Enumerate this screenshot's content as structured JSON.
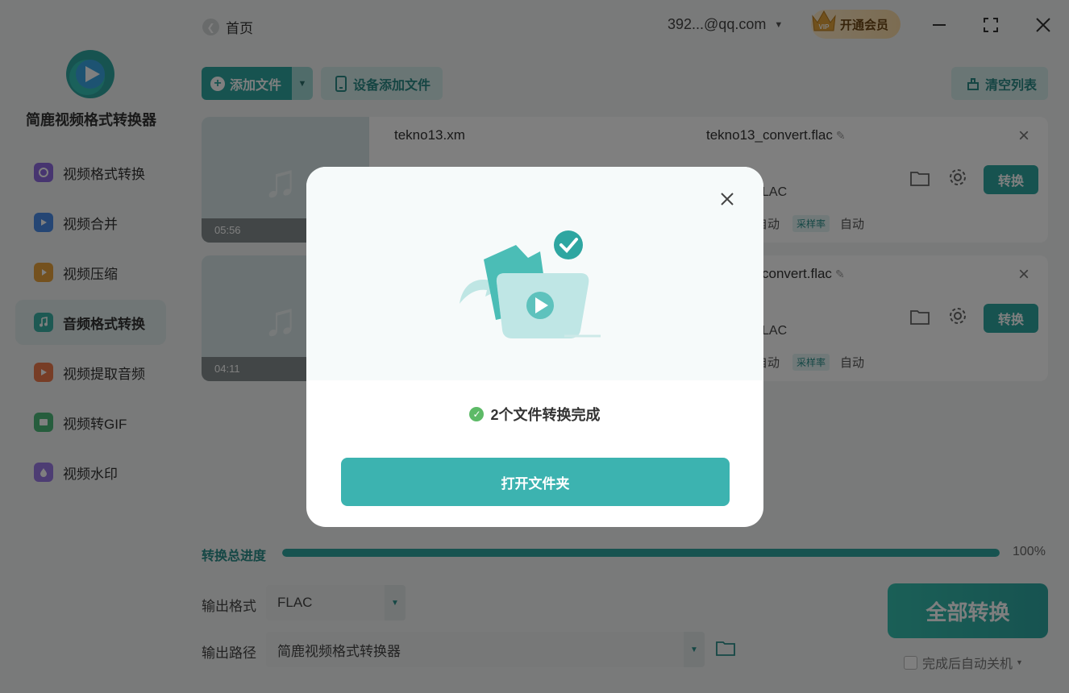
{
  "app": {
    "name": "简鹿视频格式转换器"
  },
  "colors": {
    "accent": "#2ea6a1",
    "accent_light": "#d4ecea",
    "vip_gold": "#f8d9a4"
  },
  "sidebar": {
    "items": [
      {
        "label": "视频格式转换",
        "icon": "video-convert-icon",
        "color": "#8e6be0"
      },
      {
        "label": "视频合并",
        "icon": "video-merge-icon",
        "color": "#4a8de8"
      },
      {
        "label": "视频压缩",
        "icon": "video-compress-icon",
        "color": "#e8a33c"
      },
      {
        "label": "音频格式转换",
        "icon": "audio-convert-icon",
        "color": "#3bb3a7",
        "active": true
      },
      {
        "label": "视频提取音频",
        "icon": "extract-audio-icon",
        "color": "#ef7a4c"
      },
      {
        "label": "视频转GIF",
        "icon": "gif-icon",
        "color": "#4cba7b"
      },
      {
        "label": "视频水印",
        "icon": "watermark-icon",
        "color": "#9b7be6"
      }
    ]
  },
  "header": {
    "back_label": "首页",
    "account": "392...@qq.com",
    "vip_label": "开通会员",
    "vip_badge": "VIP"
  },
  "toolbar": {
    "add_file": "添加文件",
    "device_add": "设备添加文件",
    "clear_list": "清空列表"
  },
  "files": [
    {
      "name": "tekno13.xm",
      "output": "tekno13_convert.flac",
      "duration": "05:56",
      "format": "LAC",
      "bitrate": "自动",
      "rate_label": "采样率",
      "rate": "自动",
      "convert": "转换"
    },
    {
      "name": "",
      "output": "convert.flac",
      "duration": "04:11",
      "format": "LAC",
      "bitrate": "自动",
      "rate_label": "采样率",
      "rate": "自动",
      "convert": "转换"
    }
  ],
  "progress": {
    "label": "转换总进度",
    "percent_text": "100%",
    "value": 100
  },
  "output": {
    "format_label": "输出格式",
    "format_value": "FLAC",
    "path_label": "输出路径",
    "path_value": "简鹿视频格式转换器"
  },
  "actions": {
    "convert_all": "全部转换",
    "shutdown": "完成后自动关机"
  },
  "modal": {
    "message": "2个文件转换完成",
    "open_folder": "打开文件夹"
  }
}
